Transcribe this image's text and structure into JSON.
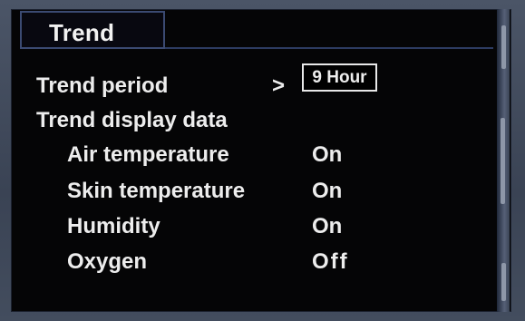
{
  "header": {
    "tab_label": "Trend"
  },
  "menu": {
    "trend_period": {
      "label": "Trend period",
      "arrow": ">",
      "value": "9 Hour"
    },
    "trend_display_data_label": "Trend display data",
    "items": [
      {
        "label": "Air temperature",
        "value": "On"
      },
      {
        "label": "Skin temperature",
        "value": "On"
      },
      {
        "label": "Humidity",
        "value": "On"
      },
      {
        "label": "Oxygen",
        "value": "Off"
      }
    ]
  }
}
